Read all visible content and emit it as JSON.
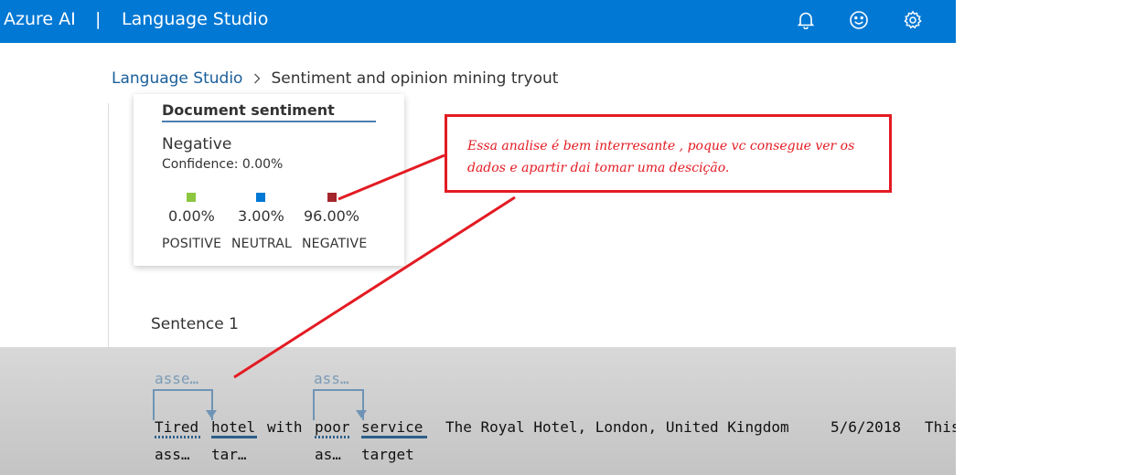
{
  "header": {
    "brand": "Azure AI",
    "separator": "|",
    "product": "Language Studio",
    "icons": [
      "bell-icon",
      "smiley-icon",
      "gear-icon"
    ]
  },
  "breadcrumb": {
    "root": "Language Studio",
    "current": "Sentiment and opinion mining tryout"
  },
  "document_sentiment": {
    "title": "Document sentiment",
    "label": "Negative",
    "confidence": "Confidence: 0.00%",
    "metrics": [
      {
        "value": "0.00%",
        "label": "POSITIVE",
        "color": "#8dc63f"
      },
      {
        "value": "3.00%",
        "label": "NEUTRAL",
        "color": "#0078d4"
      },
      {
        "value": "96.00%",
        "label": "NEGATIVE",
        "color": "#a4262c"
      }
    ]
  },
  "sentence": {
    "title": "Sentence 1",
    "top_labels": [
      "asse…",
      "ass…"
    ],
    "tokens": [
      "Tired",
      "hotel",
      "with",
      "poor",
      "service",
      "The Royal Hotel, London, United Kingdom",
      "5/6/2018",
      "This"
    ],
    "bottom_labels": [
      "ass…",
      "tar…",
      "as…",
      "target"
    ]
  },
  "annotation": {
    "text": "Essa analise é bem interresante , poque vc consegue ver os dados e apartir dai tomar uma descição.",
    "color": "#e31b23"
  },
  "colors": {
    "header": "#0078d4",
    "link": "#1a5e9a"
  }
}
